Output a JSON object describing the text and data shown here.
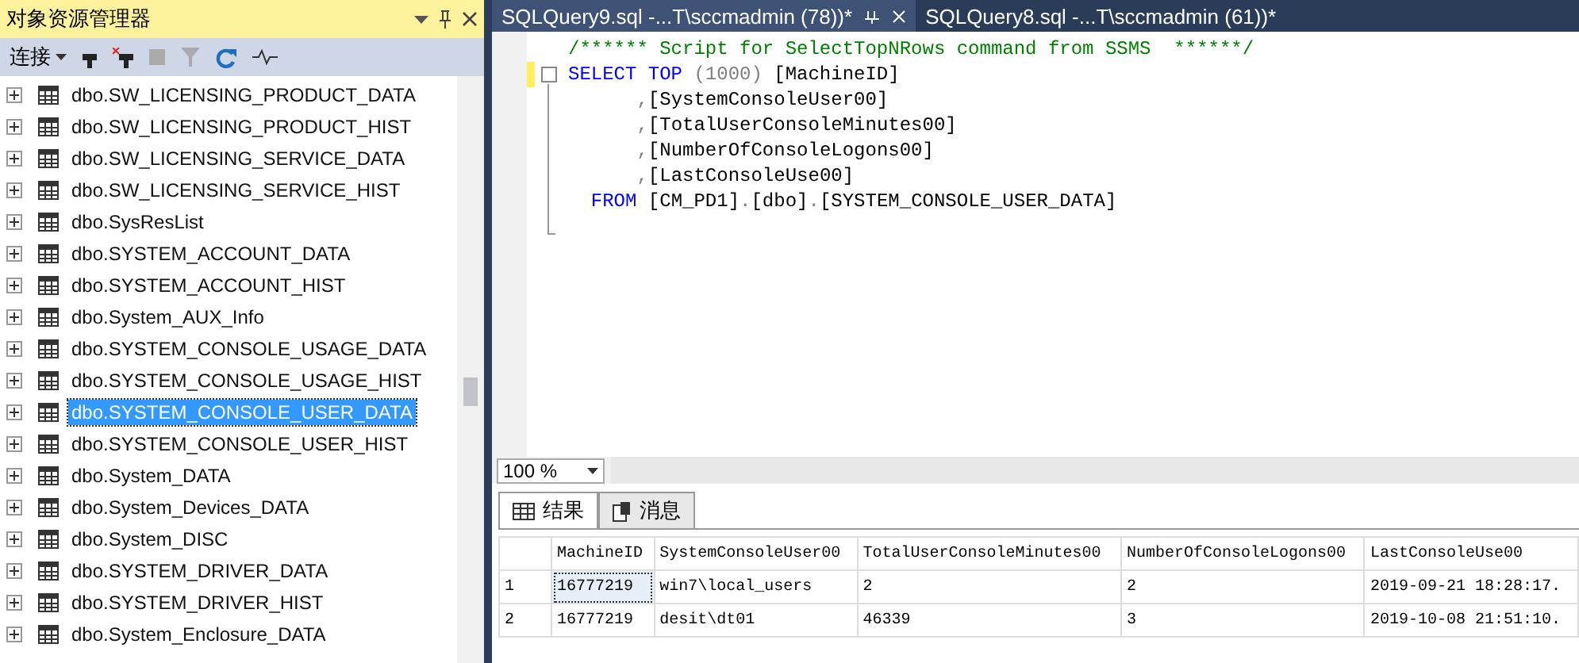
{
  "explorer": {
    "title": "对象资源管理器",
    "connect": "连接",
    "items": [
      {
        "label": "dbo.SW_LICENSING_PRODUCT_DATA",
        "selected": false
      },
      {
        "label": "dbo.SW_LICENSING_PRODUCT_HIST",
        "selected": false
      },
      {
        "label": "dbo.SW_LICENSING_SERVICE_DATA",
        "selected": false
      },
      {
        "label": "dbo.SW_LICENSING_SERVICE_HIST",
        "selected": false
      },
      {
        "label": "dbo.SysResList",
        "selected": false
      },
      {
        "label": "dbo.SYSTEM_ACCOUNT_DATA",
        "selected": false
      },
      {
        "label": "dbo.SYSTEM_ACCOUNT_HIST",
        "selected": false
      },
      {
        "label": "dbo.System_AUX_Info",
        "selected": false
      },
      {
        "label": "dbo.SYSTEM_CONSOLE_USAGE_DATA",
        "selected": false
      },
      {
        "label": "dbo.SYSTEM_CONSOLE_USAGE_HIST",
        "selected": false
      },
      {
        "label": "dbo.SYSTEM_CONSOLE_USER_DATA",
        "selected": true
      },
      {
        "label": "dbo.SYSTEM_CONSOLE_USER_HIST",
        "selected": false
      },
      {
        "label": "dbo.System_DATA",
        "selected": false
      },
      {
        "label": "dbo.System_Devices_DATA",
        "selected": false
      },
      {
        "label": "dbo.System_DISC",
        "selected": false
      },
      {
        "label": "dbo.SYSTEM_DRIVER_DATA",
        "selected": false
      },
      {
        "label": "dbo.SYSTEM_DRIVER_HIST",
        "selected": false
      },
      {
        "label": "dbo.System_Enclosure_DATA",
        "selected": false
      }
    ]
  },
  "tabs": [
    {
      "label": "SQLQuery9.sql -...T\\sccmadmin (78))*",
      "selected": true
    },
    {
      "label": "SQLQuery8.sql -...T\\sccmadmin (61))*",
      "selected": false
    }
  ],
  "code": [
    [
      {
        "kind": "comment",
        "text": "/****** Script for SelectTopNRows command from SSMS  ******/"
      }
    ],
    [
      {
        "kind": "keyword",
        "text": "SELECT TOP"
      },
      {
        "kind": "operator",
        "text": " (1000) "
      },
      {
        "kind": "plain",
        "text": "[MachineID]"
      }
    ],
    [
      {
        "kind": "operator",
        "text": "      ,"
      },
      {
        "kind": "plain",
        "text": "[SystemConsoleUser00]"
      }
    ],
    [
      {
        "kind": "operator",
        "text": "      ,"
      },
      {
        "kind": "plain",
        "text": "[TotalUserConsoleMinutes00]"
      }
    ],
    [
      {
        "kind": "operator",
        "text": "      ,"
      },
      {
        "kind": "plain",
        "text": "[NumberOfConsoleLogons00]"
      }
    ],
    [
      {
        "kind": "operator",
        "text": "      ,"
      },
      {
        "kind": "plain",
        "text": "[LastConsoleUse00]"
      }
    ],
    [
      {
        "kind": "keyword",
        "text": "  FROM "
      },
      {
        "kind": "plain",
        "text": "[CM_PD1]"
      },
      {
        "kind": "operator",
        "text": "."
      },
      {
        "kind": "plain",
        "text": "[dbo]"
      },
      {
        "kind": "operator",
        "text": "."
      },
      {
        "kind": "plain",
        "text": "[SYSTEM_CONSOLE_USER_DATA]"
      }
    ]
  ],
  "zoom": "100 %",
  "result_tabs": [
    {
      "label": "结果",
      "selected": true
    },
    {
      "label": "消息",
      "selected": false
    }
  ],
  "grid": {
    "columns": [
      "MachineID",
      "SystemConsoleUser00",
      "TotalUserConsoleMinutes00",
      "NumberOfConsoleLogons00",
      "LastConsoleUse00"
    ],
    "rows": [
      {
        "number": "1",
        "cells": [
          "16777219",
          "win7\\local_users",
          "2",
          "2",
          "2019-09-21 18:28:17."
        ]
      },
      {
        "number": "2",
        "cells": [
          "16777219",
          "desit\\dt01",
          "46339",
          "3",
          "2019-10-08 21:51:10."
        ]
      }
    ]
  }
}
